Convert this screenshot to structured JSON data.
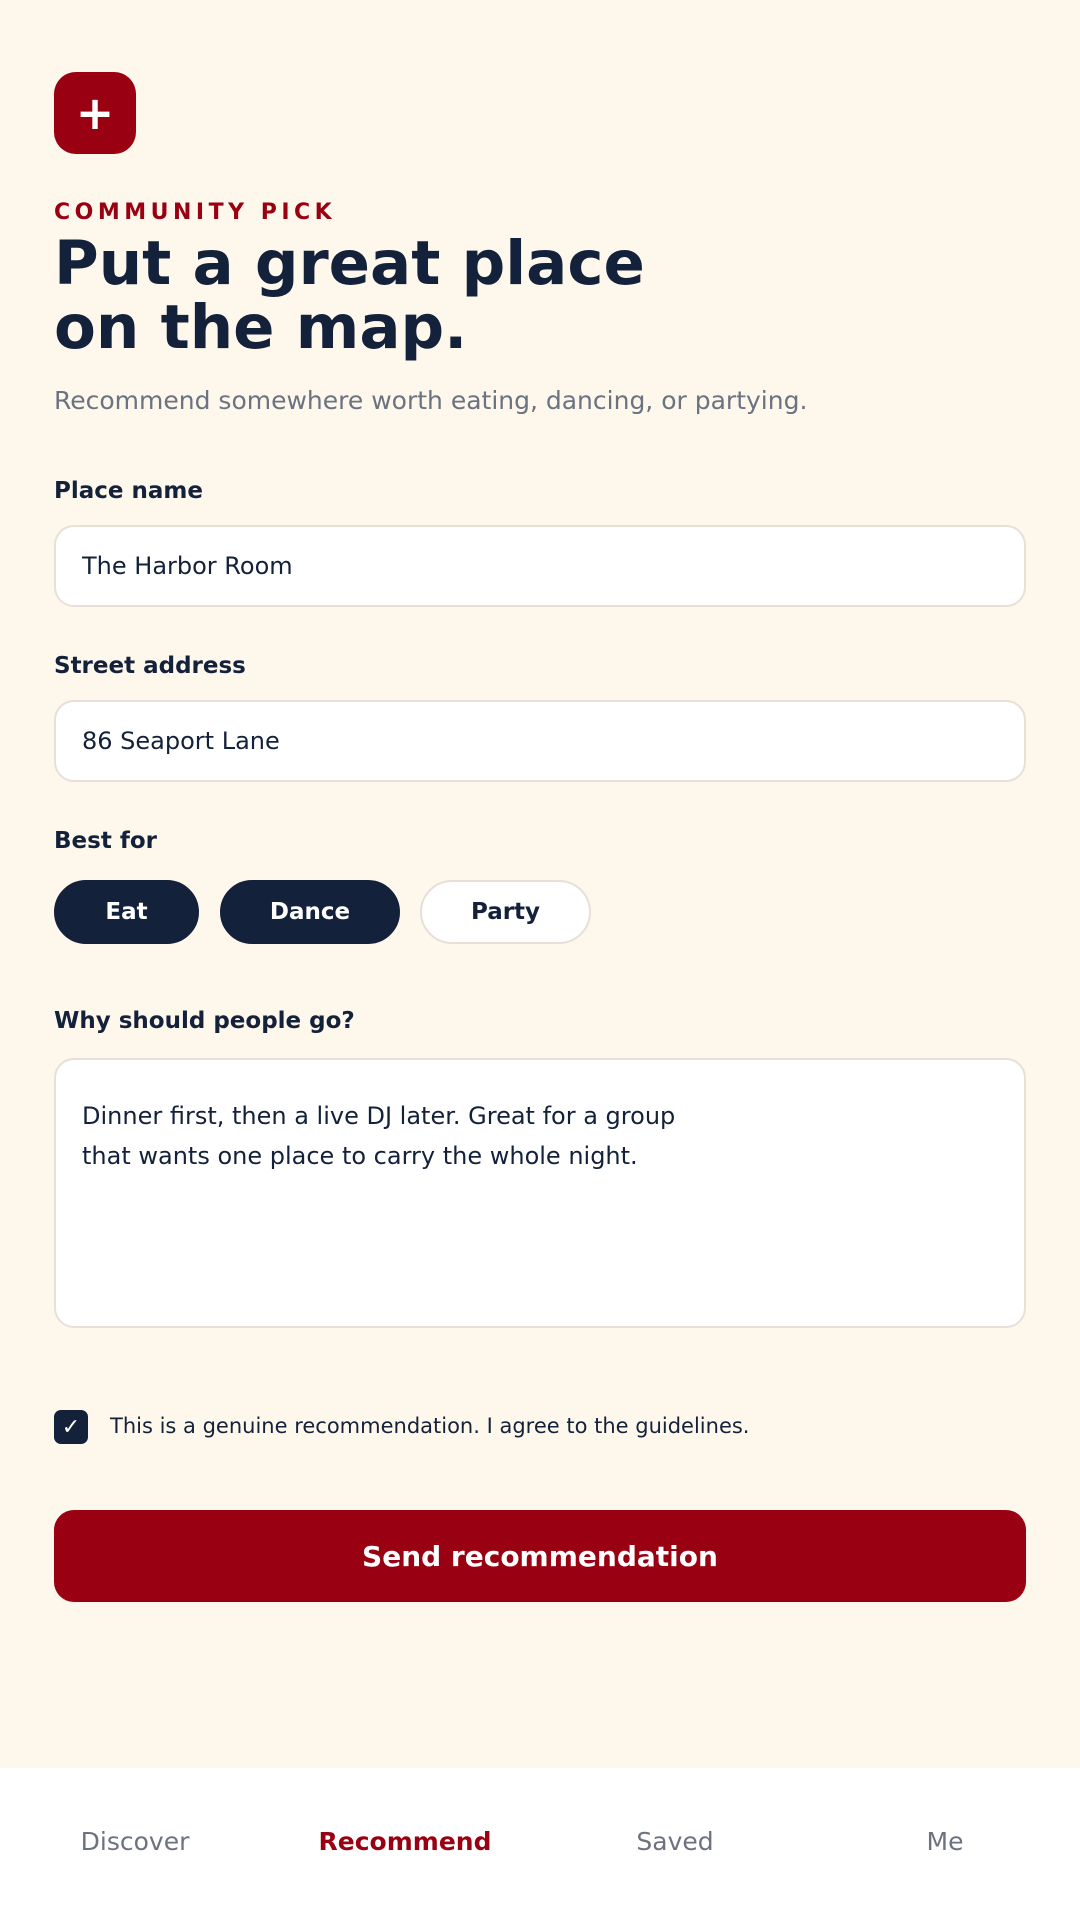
{
  "header": {
    "app_icon_glyph": "+",
    "eyebrow": "COMMUNITY PICK",
    "title_line1": "Put a great place",
    "title_line2": "on the map.",
    "subtitle": "Recommend somewhere worth eating, dancing, or partying."
  },
  "form": {
    "place_name": {
      "label": "Place name",
      "value": "The Harbor Room"
    },
    "street_address": {
      "label": "Street address",
      "value": "86 Seaport Lane"
    },
    "best_for": {
      "label": "Best for",
      "options": [
        {
          "label": "Eat",
          "selected": true
        },
        {
          "label": "Dance",
          "selected": true
        },
        {
          "label": "Party",
          "selected": false
        }
      ]
    },
    "why": {
      "label": "Why should people go?",
      "line1": "Dinner first, then a live DJ later. Great for a group",
      "line2": "that wants one place to carry the whole night."
    },
    "agreement": {
      "checked": true,
      "check_glyph": "✓",
      "label": "This is a genuine recommendation. I agree to the guidelines."
    },
    "submit_label": "Send recommendation"
  },
  "tabbar": {
    "items": [
      {
        "label": "Discover",
        "active": false
      },
      {
        "label": "Recommend",
        "active": true
      },
      {
        "label": "Saved",
        "active": false
      },
      {
        "label": "Me",
        "active": false
      }
    ]
  },
  "colors": {
    "background": "#FEF7EC",
    "accent": "#990011",
    "navy": "#14213A",
    "muted": "#6B7280"
  }
}
